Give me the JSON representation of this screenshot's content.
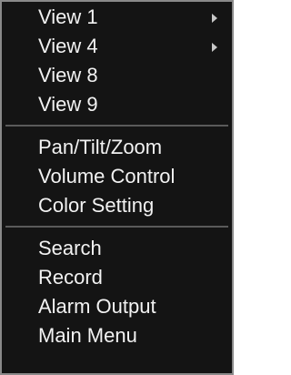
{
  "menu": {
    "groups": [
      {
        "items": [
          {
            "label": "View 1",
            "submenu": true,
            "icon": "chevron-right-icon"
          },
          {
            "label": "View 4",
            "submenu": true,
            "icon": "chevron-right-icon"
          },
          {
            "label": "View 8",
            "submenu": false
          },
          {
            "label": "View 9",
            "submenu": false
          }
        ]
      },
      {
        "items": [
          {
            "label": "Pan/Tilt/Zoom"
          },
          {
            "label": "Volume Control"
          },
          {
            "label": "Color Setting"
          }
        ]
      },
      {
        "items": [
          {
            "label": "Search"
          },
          {
            "label": "Record"
          },
          {
            "label": "Alarm Output"
          },
          {
            "label": "Main Menu"
          }
        ]
      }
    ]
  },
  "colors": {
    "background": "#141414",
    "text": "#f2f2f2",
    "border": "#8a8a8a",
    "divider": "#5a5a5a"
  }
}
